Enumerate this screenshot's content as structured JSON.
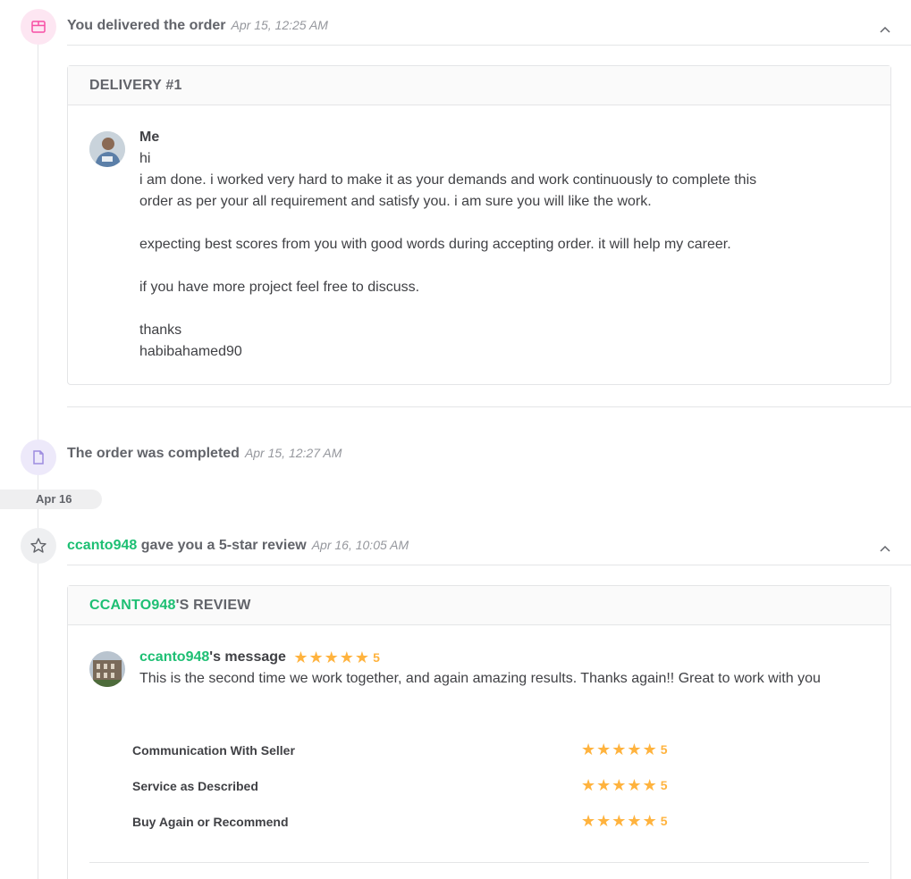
{
  "events": {
    "delivered": {
      "title": "You delivered the order",
      "time": "Apr 15, 12:25 AM"
    },
    "completed": {
      "title": "The order was completed",
      "time": "Apr 15, 12:27 AM"
    },
    "review": {
      "user": "ccanto948",
      "title_suffix": " gave you a 5-star review",
      "time": "Apr 16, 10:05 AM"
    }
  },
  "delivery": {
    "heading": "DELIVERY #1",
    "sender": "Me",
    "message": "hi\ni am done. i worked very hard to make it as your demands and work continuously to complete this\norder as per your all requirement and satisfy you. i am sure you will like the work.\n\nexpecting best scores from you with good words during accepting order. it will help my career.\n\nif you have more project feel free to discuss.\n\nthanks\nhabibahamed90"
  },
  "date_separator": "Apr 16",
  "review": {
    "heading_user": "CCANTO948",
    "heading_suffix": "'S REVIEW",
    "reviewer": "ccanto948",
    "message_label": "'s message",
    "overall_rating": "5",
    "text": "This is the second time we work together, and again amazing results. Thanks again!! Great to work with you",
    "ratings": [
      {
        "label": "Communication With Seller",
        "value": "5"
      },
      {
        "label": "Service as Described",
        "value": "5"
      },
      {
        "label": "Buy Again or Recommend",
        "value": "5"
      }
    ]
  },
  "colors": {
    "accent": "#1dbf73",
    "star": "#ffb33e",
    "delivery_icon": "#f74fa5",
    "completed_icon": "#9d8ce0",
    "review_icon": "#62646a"
  },
  "icons": {
    "delivered": "package-icon",
    "completed": "document-icon",
    "review": "star-outline-icon",
    "collapse": "chevron-up-icon"
  }
}
